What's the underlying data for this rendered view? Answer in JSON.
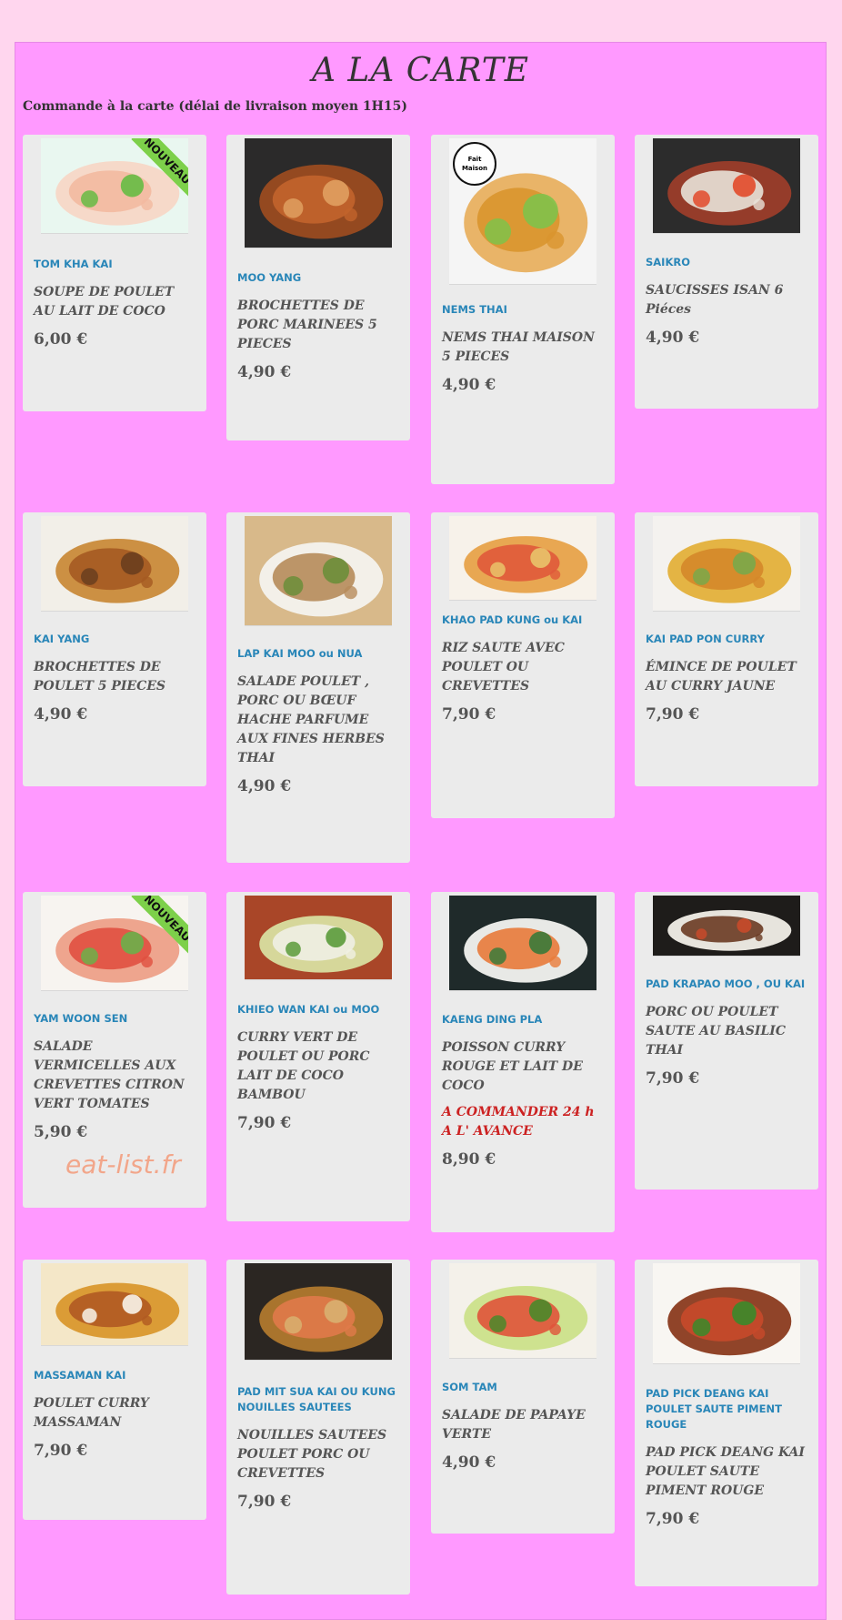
{
  "title": "A LA CARTE",
  "subtitle": "Commande à la carte (délai de livraison moyen 1H15)",
  "watermark": "eat-list.fr",
  "items": [
    {
      "code": "TOM KHA KAI",
      "desc": "SOUPE DE POULET AU LAIT DE COCO",
      "price": "6,00 €",
      "badge": "NOUVEAU",
      "img": "soup",
      "colors": [
        "#e9f7f0",
        "#f7d7c6",
        "#f3b9a0",
        "#66bb44"
      ]
    },
    {
      "code": "MOO YANG",
      "desc": "BROCHETTES DE PORC MARINEES 5 PIECES",
      "price": "4,90 €",
      "img": "skewers",
      "colors": [
        "#2b2a2a",
        "#9a4b20",
        "#c2642c",
        "#e0a060"
      ]
    },
    {
      "code": "NEMS THAI",
      "desc": "NEMS THAI MAISON 5 PIECES",
      "price": "4,90 €",
      "logo": "Fait Maison",
      "img": "nems",
      "colors": [
        "#f5f5f5",
        "#e8b060",
        "#d9952e",
        "#7fc24a"
      ]
    },
    {
      "code": "SAIKRO",
      "desc": "SAUCISSES ISAN 6 Piéces",
      "price": "4,90 €",
      "img": "sausage",
      "colors": [
        "#2c2c2c",
        "#9b3d2a",
        "#e8e2d8",
        "#e24a2a"
      ]
    },
    {
      "code": "KAI YANG",
      "desc": "BROCHETTES DE POULET 5 PIECES",
      "price": "4,90 €",
      "img": "satay",
      "colors": [
        "#f2efe8",
        "#c98a3a",
        "#a55a22",
        "#6a3e1e"
      ]
    },
    {
      "code": "LAP KAI MOO ou NUA",
      "desc": "SALADE POULET , PORC OU BŒUF HACHE PARFUME AUX FINES HERBES THAI",
      "price": "4,90 €",
      "img": "larb",
      "colors": [
        "#d8b98a",
        "#f4f2ee",
        "#b68b5a",
        "#6b8e3a"
      ]
    },
    {
      "code": "KHAO PAD KUNG ou KAI",
      "desc": "RIZ SAUTE AVEC POULET OU CREVETTES",
      "price": "7,90 €",
      "img": "rice",
      "colors": [
        "#f7f2ea",
        "#e7a24a",
        "#e05a3a",
        "#e9c46a"
      ]
    },
    {
      "code": "KAI PAD PON CURRY",
      "desc": "ÉMINCE DE POULET AU CURRY JAUNE",
      "price": "7,90 €",
      "img": "curry",
      "colors": [
        "#f4f2ef",
        "#e3b03a",
        "#d4872a",
        "#7aa84a"
      ]
    },
    {
      "code": "YAM WOON SEN",
      "desc": "SALADE VERMICELLES AUX CREVETTES CITRON VERT TOMATES",
      "price": "5,90 €",
      "badge": "NOUVEAU",
      "img": "vermicelli",
      "colors": [
        "#f7f4f0",
        "#eda088",
        "#e05040",
        "#6cb04a"
      ]
    },
    {
      "code": "KHIEO WAN KAI ou MOO",
      "desc": "CURRY VERT DE POULET OU PORC LAIT DE COCO BAMBOU",
      "price": "7,90 €",
      "img": "green",
      "colors": [
        "#a94628",
        "#d8dfa0",
        "#f0f0e4",
        "#5a9a3a"
      ]
    },
    {
      "code": "KAENG DING PLA",
      "desc": "POISSON CURRY ROUGE ET LAIT DE COCO",
      "note": "A COMMANDER 24 h  A L' AVANCE",
      "price": "8,90 €",
      "img": "fish",
      "colors": [
        "#1f2a2a",
        "#f3f3f0",
        "#e87a3a",
        "#3a7a3a"
      ]
    },
    {
      "code": "PAD KRAPAO MOO , OU KAI",
      "desc": "PORC OU POULET SAUTE AU BASILIC THAI",
      "price": "7,90 €",
      "img": "krapao",
      "colors": [
        "#1e1c1a",
        "#f2efe8",
        "#6a3a22",
        "#c84a2a"
      ]
    },
    {
      "code": "MASSAMAN KAI",
      "desc": "POULET CURRY MASSAMAN",
      "price": "7,90 €",
      "img": "massaman",
      "colors": [
        "#f4e7c8",
        "#d9982e",
        "#b05a22",
        "#f8f4ea"
      ]
    },
    {
      "code": "PAD MIT SUA KAI OU KUNG NOUILLES SAUTEES",
      "desc": "NOUILLES SAUTEES POULET PORC OU CREVETTES",
      "price": "7,90 €",
      "img": "noodles",
      "colors": [
        "#2b2622",
        "#b0782e",
        "#e07a4a",
        "#d8b070"
      ]
    },
    {
      "code": "SOM TAM",
      "desc": "SALADE DE PAPAYE VERTE",
      "price": "4,90 €",
      "img": "papaya",
      "colors": [
        "#f4f1ea",
        "#cbe08a",
        "#e0543a",
        "#4a8a2a"
      ]
    },
    {
      "code": "PAD PICK DEANG KAI POULET SAUTE PIMENT ROUGE",
      "desc": "PAD PICK DEANG KAI POULET SAUTE PIMENT ROUGE",
      "price": "7,90 €",
      "img": "chili",
      "colors": [
        "#f8f6f2",
        "#8a3a1e",
        "#c84a2a",
        "#3a8a2a"
      ]
    }
  ]
}
